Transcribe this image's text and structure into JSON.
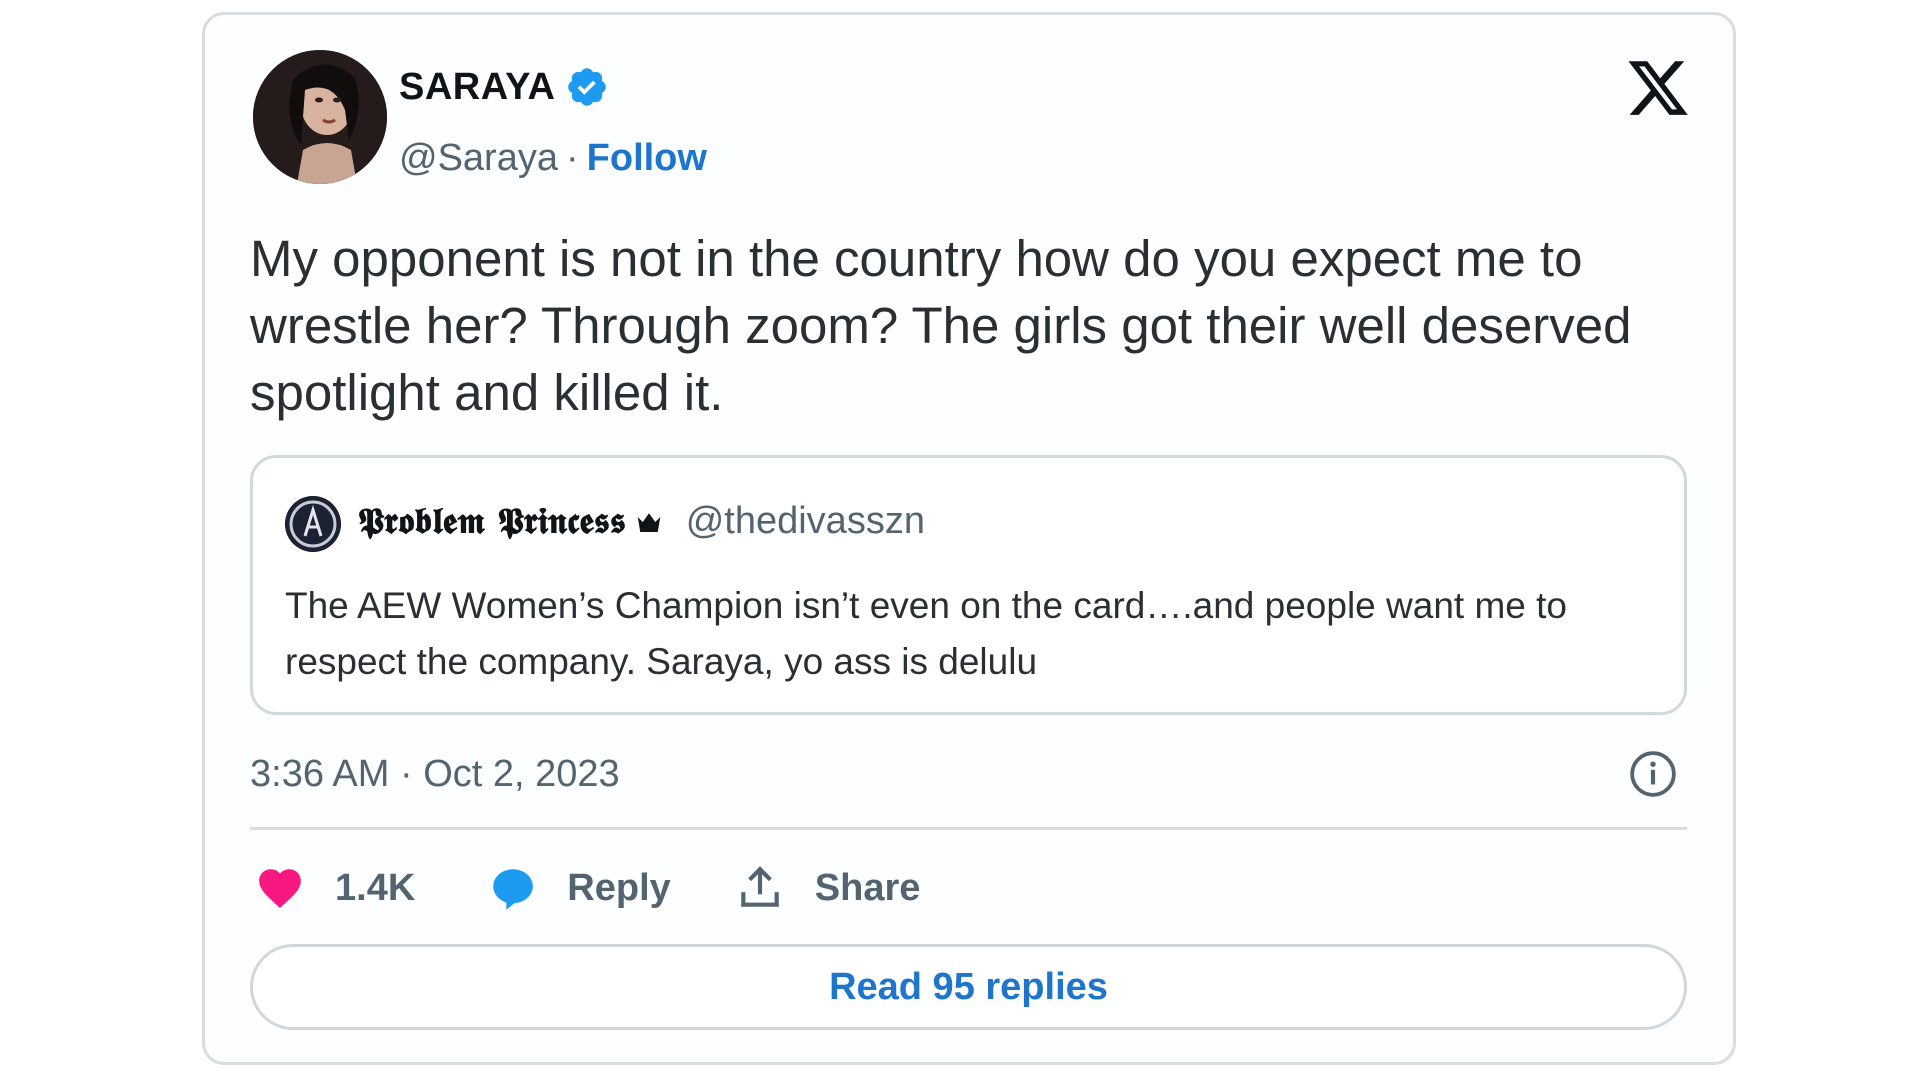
{
  "author": {
    "display_name": "SARAYA",
    "handle": "@Saraya",
    "separator": "·",
    "follow_label": "Follow",
    "verified": true
  },
  "tweet": {
    "text": "My opponent is not in the country how do you expect me to wrestle her? Through zoom? The girls got their well deserved spotlight and killed it.",
    "timestamp": "3:36 AM · Oct 2, 2023"
  },
  "quoted_tweet": {
    "display_name": "𝕻𝖗𝖔𝖇𝖑𝖊𝖒 𝕻𝖗𝖎𝖓𝖈𝖊𝖘𝖘",
    "handle": "@thedivasszn",
    "text": "The AEW Women’s Champion isn’t even on the card….and people want me to respect the company. Saraya, yo ass is delulu"
  },
  "actions": {
    "like_count": "1.4K",
    "reply_label": "Reply",
    "share_label": "Share"
  },
  "read_replies_label": "Read 95 replies",
  "colors": {
    "link_blue": "#1d75cc",
    "verified_blue": "#1d9bf0",
    "like_pink": "#f91880",
    "reply_blue": "#1d9bf0",
    "muted_text": "#536471"
  },
  "icons": [
    "verified-badge-icon",
    "x-logo-icon",
    "crown-icon",
    "info-icon",
    "heart-icon",
    "reply-bubble-icon",
    "share-icon"
  ]
}
